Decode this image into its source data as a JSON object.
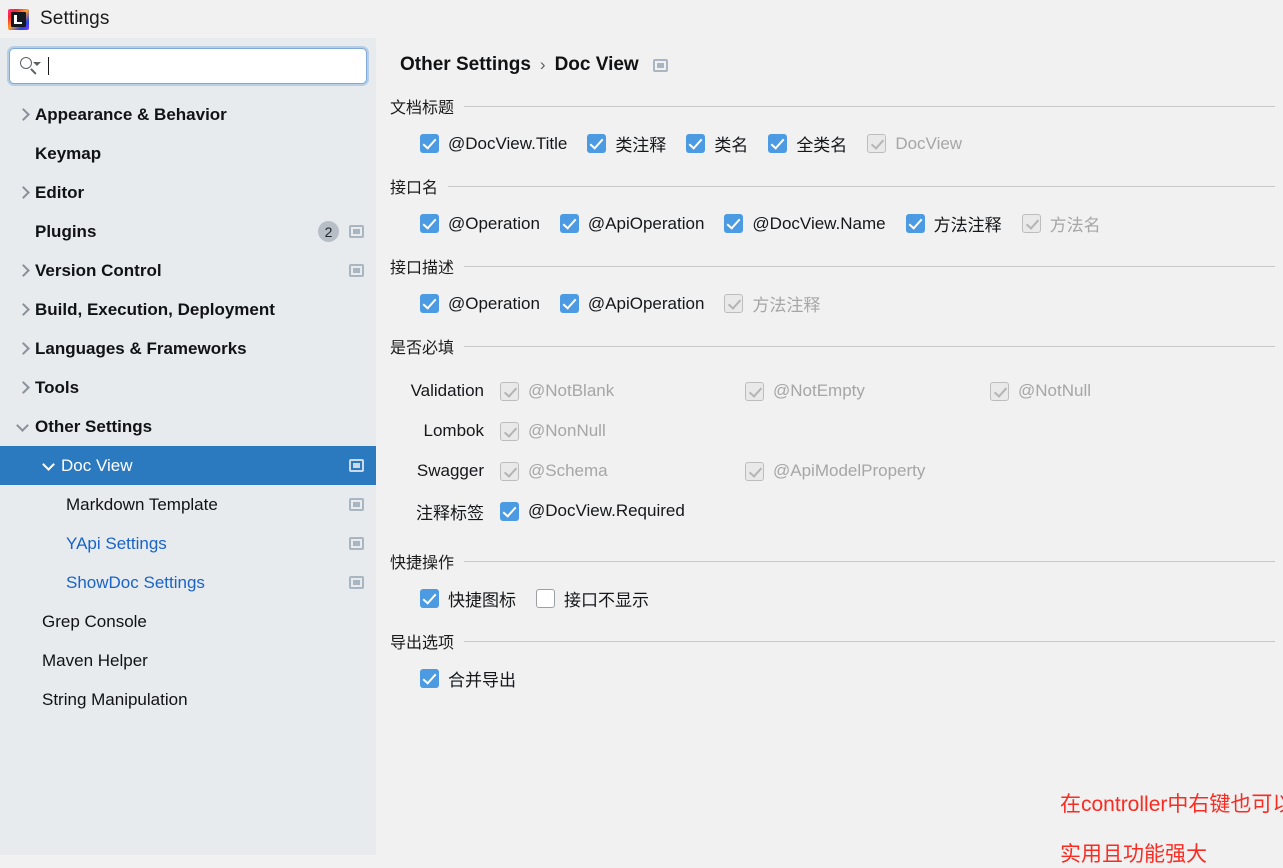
{
  "window": {
    "title": "Settings",
    "app_icon": "intellij-idea-icon"
  },
  "search": {
    "placeholder": "",
    "value": "",
    "icon": "search-icon"
  },
  "sidebar": {
    "items": [
      {
        "label": "Appearance & Behavior",
        "level": 0,
        "chevron": "right",
        "badge": "",
        "modified": false,
        "selected": false,
        "link": false
      },
      {
        "label": "Keymap",
        "level": 0,
        "chevron": "none",
        "badge": "",
        "modified": false,
        "selected": false,
        "link": false
      },
      {
        "label": "Editor",
        "level": 0,
        "chevron": "right",
        "badge": "",
        "modified": false,
        "selected": false,
        "link": false
      },
      {
        "label": "Plugins",
        "level": 0,
        "chevron": "none",
        "badge": "2",
        "modified": true,
        "selected": false,
        "link": false
      },
      {
        "label": "Version Control",
        "level": 0,
        "chevron": "right",
        "badge": "",
        "modified": true,
        "selected": false,
        "link": false
      },
      {
        "label": "Build, Execution, Deployment",
        "level": 0,
        "chevron": "right",
        "badge": "",
        "modified": false,
        "selected": false,
        "link": false
      },
      {
        "label": "Languages & Frameworks",
        "level": 0,
        "chevron": "right",
        "badge": "",
        "modified": false,
        "selected": false,
        "link": false
      },
      {
        "label": "Tools",
        "level": 0,
        "chevron": "right",
        "badge": "",
        "modified": false,
        "selected": false,
        "link": false
      },
      {
        "label": "Other Settings",
        "level": 0,
        "chevron": "down",
        "badge": "",
        "modified": false,
        "selected": false,
        "link": false
      },
      {
        "label": "Doc View",
        "level": 1,
        "chevron": "down",
        "badge": "",
        "modified": true,
        "selected": true,
        "link": false
      },
      {
        "label": "Markdown Template",
        "level": 2,
        "chevron": "none",
        "badge": "",
        "modified": true,
        "selected": false,
        "link": false
      },
      {
        "label": "YApi Settings",
        "level": 2,
        "chevron": "none",
        "badge": "",
        "modified": true,
        "selected": false,
        "link": true
      },
      {
        "label": "ShowDoc Settings",
        "level": 2,
        "chevron": "none",
        "badge": "",
        "modified": true,
        "selected": false,
        "link": true
      },
      {
        "label": "Grep Console",
        "level": 1,
        "chevron": "none",
        "badge": "",
        "modified": false,
        "selected": false,
        "link": false
      },
      {
        "label": "Maven Helper",
        "level": 1,
        "chevron": "none",
        "badge": "",
        "modified": false,
        "selected": false,
        "link": false
      },
      {
        "label": "String Manipulation",
        "level": 1,
        "chevron": "none",
        "badge": "",
        "modified": false,
        "selected": false,
        "link": false
      }
    ]
  },
  "breadcrumb": {
    "parts": [
      "Other Settings",
      "Doc View"
    ],
    "separator": "›",
    "modified_icon": "modified-settings-icon"
  },
  "sections": [
    {
      "title": "文档标题",
      "checkboxes": [
        {
          "label": "@DocView.Title",
          "state": "on"
        },
        {
          "label": "类注释",
          "state": "on"
        },
        {
          "label": "类名",
          "state": "on"
        },
        {
          "label": "全类名",
          "state": "on"
        },
        {
          "label": "DocView",
          "state": "dis"
        }
      ]
    },
    {
      "title": "接口名",
      "checkboxes": [
        {
          "label": "@Operation",
          "state": "on"
        },
        {
          "label": "@ApiOperation",
          "state": "on"
        },
        {
          "label": "@DocView.Name",
          "state": "on"
        },
        {
          "label": "方法注释",
          "state": "on"
        },
        {
          "label": "方法名",
          "state": "dis"
        }
      ]
    },
    {
      "title": "接口描述",
      "checkboxes": [
        {
          "label": "@Operation",
          "state": "on"
        },
        {
          "label": "@ApiOperation",
          "state": "on"
        },
        {
          "label": "方法注释",
          "state": "dis"
        }
      ]
    }
  ],
  "required_section": {
    "title": "是否必填",
    "rows": [
      {
        "label": "Validation",
        "checkboxes": [
          {
            "label": "@NotBlank",
            "state": "dis"
          },
          {
            "label": "@NotEmpty",
            "state": "dis"
          },
          {
            "label": "@NotNull",
            "state": "dis"
          }
        ]
      },
      {
        "label": "Lombok",
        "checkboxes": [
          {
            "label": "@NonNull",
            "state": "dis"
          }
        ]
      },
      {
        "label": "Swagger",
        "checkboxes": [
          {
            "label": "@Schema",
            "state": "dis"
          },
          {
            "label": "@ApiModelProperty",
            "state": "dis"
          }
        ]
      },
      {
        "label": "注释标签",
        "checkboxes": [
          {
            "label": "@DocView.Required",
            "state": "on"
          }
        ]
      }
    ]
  },
  "shortcut_section": {
    "title": "快捷操作",
    "checkboxes": [
      {
        "label": "快捷图标",
        "state": "on"
      },
      {
        "label": "接口不显示",
        "state": "off"
      }
    ]
  },
  "export_section": {
    "title": "导出选项",
    "checkboxes": [
      {
        "label": "合并导出",
        "state": "on"
      }
    ]
  },
  "annotations": [
    {
      "text": "在controller中右键也可以生成",
      "color": "#f82c23"
    },
    {
      "text": "实用且功能强大",
      "color": "#f82c23"
    }
  ],
  "colors": {
    "selection": "#2b7ac0",
    "checkbox_on": "#4b9ae2",
    "link": "#1a63c7",
    "annotation_red": "#f82c23",
    "sidebar_bg": "#e7ebee",
    "panel_bg": "#f1f1f1"
  }
}
